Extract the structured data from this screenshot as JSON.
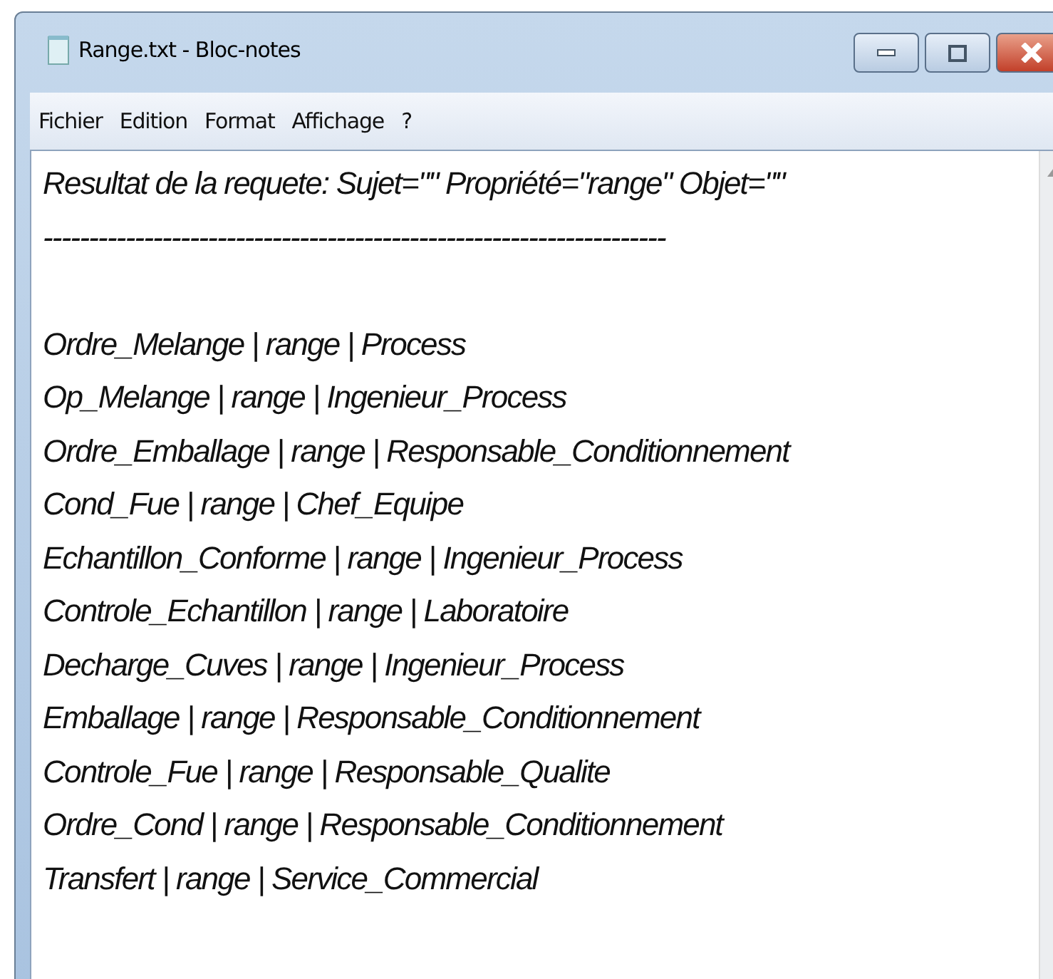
{
  "window": {
    "title": "Range.txt - Bloc-notes"
  },
  "menu": [
    "Fichier",
    "Edition",
    "Format",
    "Affichage",
    "?"
  ],
  "document": {
    "header": "Resultat de la requete: Sujet=\"\" Propriété=\"range\" Objet=\"\"",
    "separator": "--------------------------------------------------------------------",
    "lines": [
      "Ordre_Melange | range | Process",
      "Op_Melange | range | Ingenieur_Process",
      "Ordre_Emballage | range | Responsable_Conditionnement",
      "Cond_Fue | range | Chef_Equipe",
      "Echantillon_Conforme | range | Ingenieur_Process",
      "Controle_Echantillon | range | Laboratoire",
      "Decharge_Cuves | range | Ingenieur_Process",
      "Emballage | range | Responsable_Conditionnement",
      "Controle_Fue | range | Responsable_Qualite",
      "Ordre_Cond | range | Responsable_Conditionnement",
      "Transfert | range | Service_Commercial"
    ]
  }
}
